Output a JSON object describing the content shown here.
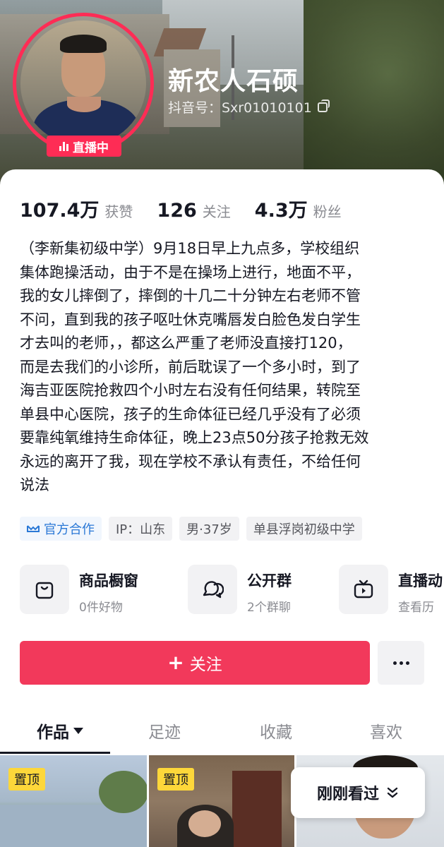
{
  "profile": {
    "nickname": "新农人石硕",
    "douyin_id": "抖音号：Sxr01010101",
    "live_badge": "直播中"
  },
  "stats": [
    {
      "value": "107.4万",
      "label": "获赞"
    },
    {
      "value": "126",
      "label": "关注"
    },
    {
      "value": "4.3万",
      "label": "粉丝"
    }
  ],
  "bio_lines": [
    "（李新集初级中学）9月18日早上九点多，学校组织",
    "集体跑操活动，由于不是在操场上进行，地面不平，",
    "我的女儿摔倒了，摔倒的十几二十分钟左右老师不管",
    "不问，直到我的孩子呕吐休克嘴唇发白脸色发白学生",
    "才去叫的老师，，都这么严重了老师没直接打120，",
    "而是去我们的小诊所，前后耽误了一个多小时，到了",
    "海吉亚医院抢救四个小时左右没有任何结果，转院至",
    "单县中心医院，孩子的生命体征已经几乎没有了必须",
    "要靠纯氧维持生命体征，晚上23点50分孩子抢救无效",
    "永远的离开了我，现在学校不承认有责任，不给任何",
    "说法"
  ],
  "tags": {
    "official": "官方合作",
    "ip": "IP：山东",
    "gender_age": "男·37岁",
    "school": "单县浮岗初级中学"
  },
  "features": [
    {
      "title": "商品橱窗",
      "sub": "0件好物",
      "icon": "bag-icon"
    },
    {
      "title": "公开群",
      "sub": "2个群聊",
      "icon": "chat-group-icon"
    },
    {
      "title": "直播动",
      "sub": "查看历",
      "icon": "tv-icon"
    }
  ],
  "actions": {
    "follow_label": "关注"
  },
  "tabs": [
    {
      "label": "作品"
    },
    {
      "label": "足迹"
    },
    {
      "label": "收藏"
    },
    {
      "label": "喜欢"
    }
  ],
  "grid": {
    "pin_label": "置顶"
  },
  "recent_pill": "刚刚看过",
  "colors": {
    "accent": "#fe2c55",
    "follow_button": "#f2395b",
    "pin": "#fdd73a",
    "official_tag": "#2a78d6"
  }
}
